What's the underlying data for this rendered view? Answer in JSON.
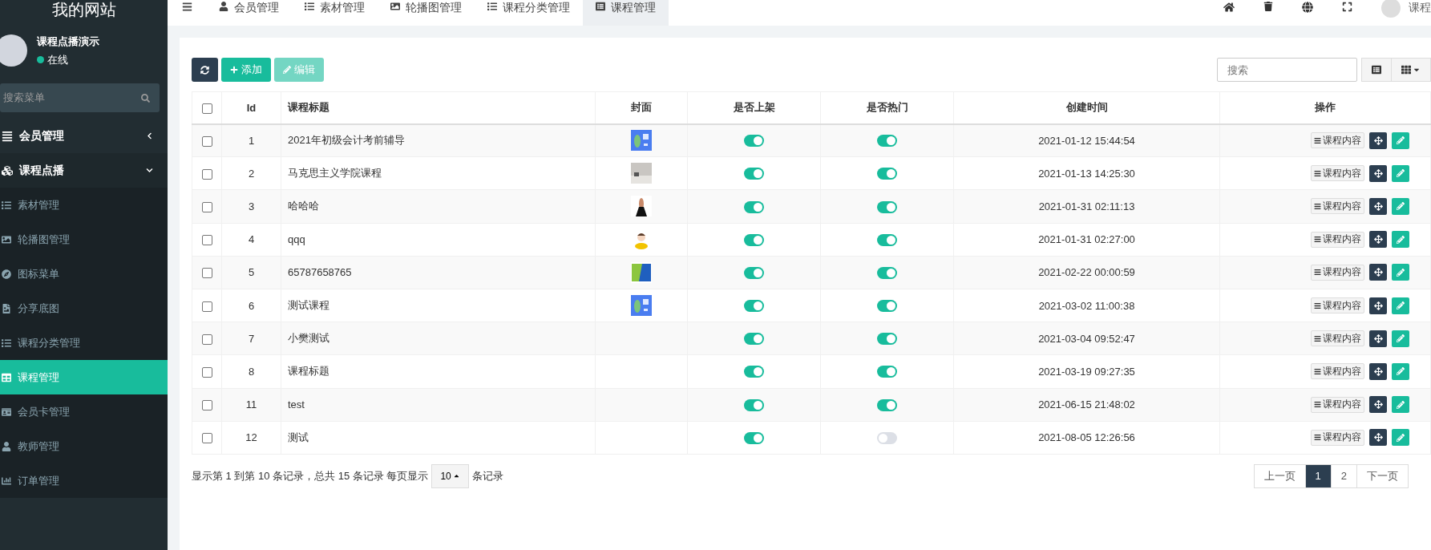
{
  "sidebar": {
    "logo": "我的网站",
    "user": {
      "name": "课程点播演示",
      "status": "在线",
      "online": true
    },
    "search": {
      "placeholder": "搜索菜单"
    },
    "items": [
      {
        "label": "会员管理",
        "expanded": false
      },
      {
        "label": "课程点播",
        "expanded": true,
        "children": [
          {
            "label": "素材管理",
            "selected": false
          },
          {
            "label": "轮播图管理",
            "selected": false
          },
          {
            "label": "图标菜单",
            "selected": false
          },
          {
            "label": "分享底图",
            "selected": false
          },
          {
            "label": "课程分类管理",
            "selected": false
          },
          {
            "label": "课程管理",
            "selected": true
          },
          {
            "label": "会员卡管理",
            "selected": false
          },
          {
            "label": "教师管理",
            "selected": false
          },
          {
            "label": "订单管理",
            "selected": false
          }
        ]
      }
    ]
  },
  "tabs": [
    {
      "label": "会员管理",
      "selected": false
    },
    {
      "label": "素材管理",
      "selected": false
    },
    {
      "label": "轮播图管理",
      "selected": false
    },
    {
      "label": "课程分类管理",
      "selected": false
    },
    {
      "label": "课程管理",
      "selected": true
    }
  ],
  "header_user": "课程",
  "toolbar": {
    "add": "添加",
    "edit": {
      "label": "编辑",
      "disabled": true
    },
    "search": {
      "placeholder": "搜索"
    }
  },
  "table": {
    "all_checked": false,
    "columns": [
      "Id",
      "课程标题",
      "封面",
      "是否上架",
      "是否热门",
      "创建时间",
      "操作"
    ],
    "rows": [
      {
        "id": "1",
        "title": "2021年初级会计考前辅导",
        "on_sale": true,
        "hot": true,
        "created": "2021-01-12 15:44:54",
        "action": "课程内容",
        "checked": false
      },
      {
        "id": "2",
        "title": "马克思主义学院课程",
        "on_sale": true,
        "hot": true,
        "created": "2021-01-13 14:25:30",
        "action": "课程内容",
        "checked": false
      },
      {
        "id": "3",
        "title": "哈哈哈",
        "on_sale": true,
        "hot": true,
        "created": "2021-01-31 02:11:13",
        "action": "课程内容",
        "checked": false
      },
      {
        "id": "4",
        "title": "qqq",
        "on_sale": true,
        "hot": true,
        "created": "2021-01-31 02:27:00",
        "action": "课程内容",
        "checked": false
      },
      {
        "id": "5",
        "title": "65787658765",
        "on_sale": true,
        "hot": true,
        "created": "2021-02-22 00:00:59",
        "action": "课程内容",
        "checked": false
      },
      {
        "id": "6",
        "title": "测试课程",
        "on_sale": true,
        "hot": true,
        "created": "2021-03-02 11:00:38",
        "action": "课程内容",
        "checked": false
      },
      {
        "id": "7",
        "title": "小樊测试",
        "on_sale": true,
        "hot": true,
        "created": "2021-03-04 09:52:47",
        "action": "课程内容",
        "checked": false
      },
      {
        "id": "8",
        "title": "课程标题",
        "on_sale": true,
        "hot": true,
        "created": "2021-03-19 09:27:35",
        "action": "课程内容",
        "checked": false
      },
      {
        "id": "11",
        "title": "test",
        "on_sale": true,
        "hot": true,
        "created": "2021-06-15 21:48:02",
        "action": "课程内容",
        "checked": false
      },
      {
        "id": "12",
        "title": "测试",
        "on_sale": true,
        "hot": false,
        "created": "2021-08-05 12:26:56",
        "action": "课程内容",
        "checked": false
      }
    ]
  },
  "footer": {
    "summary": "显示第 1 到第 10 条记录，总共 15 条记录 每页显示",
    "page_size": "10",
    "suffix": "条记录"
  },
  "pagination": [
    {
      "label": "上一页",
      "selected": false
    },
    {
      "label": "1",
      "selected": true
    },
    {
      "label": "2",
      "selected": false
    },
    {
      "label": "下一页",
      "selected": false
    }
  ]
}
